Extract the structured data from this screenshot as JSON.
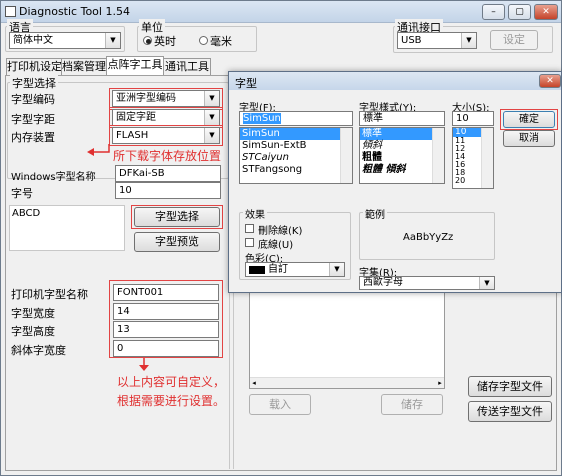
{
  "window": {
    "title": "Diagnostic Tool 1.54",
    "min": "–",
    "max": "▢",
    "close": "✕"
  },
  "language": {
    "label": "语言",
    "value": "简体中文"
  },
  "unit": {
    "label": "单位",
    "option_mm": "英时",
    "option_cm": "毫米",
    "selected": "英时"
  },
  "comm": {
    "label": "通讯接口",
    "value": "USB",
    "settings_button": "设定"
  },
  "tabs": [
    "打印机设定",
    "档案管理",
    "点阵字工具",
    "通讯工具"
  ],
  "active_tab": "点阵字工具",
  "font_select_group": {
    "title": "字型选择",
    "encoding_label": "字型编码",
    "encoding_value": "亚洲字型编码",
    "spacing_label": "字型字距",
    "spacing_value": "固定字距",
    "memory_label": "内存装置",
    "memory_value": "FLASH",
    "win_font_label": "Windows字型名称",
    "win_font_value": "DFKai-SB",
    "size_label": "字号",
    "size_value": "10",
    "sample_text": "ABCD",
    "select_font_button": "字型选择",
    "preview_button": "字型预览"
  },
  "printer_font": {
    "name_label": "打印机字型名称",
    "name_value": "FONT001",
    "width_label": "字型宽度",
    "width_value": "14",
    "height_label": "字型高度",
    "height_value": "13",
    "italic_label": "斜体字宽度",
    "italic_value": "0"
  },
  "annotations": {
    "download_location": "所下载字体存放位置",
    "custom_line1": "以上内容可自定义，",
    "custom_line2": "根据需要进行设置。"
  },
  "bottom_buttons": {
    "load": "载入",
    "save": "储存",
    "save_font_file": "储存字型文件",
    "send_font_file": "传送字型文件"
  },
  "font_dialog": {
    "title": "字型",
    "font_label": "字型(F):",
    "font_value": "SimSun",
    "fonts": [
      "SimSun",
      "SimSun-ExtB",
      "STCaiyun",
      "STFangsong"
    ],
    "selected_font": "SimSun",
    "style_label": "字型樣式(Y):",
    "style_value": "標準",
    "styles": [
      "標準",
      "傾斜",
      "粗體",
      "粗體 傾斜"
    ],
    "selected_style": "標準",
    "size_label": "大小(S):",
    "size_value": "10",
    "sizes": [
      "10",
      "11",
      "12",
      "14",
      "16",
      "18",
      "20"
    ],
    "selected_size": "10",
    "ok_button": "確定",
    "cancel_button": "取消",
    "effects_title": "效果",
    "strikeout": "刪除線(K)",
    "underline": "底線(U)",
    "color_label": "色彩(C):",
    "color_value": "自訂",
    "color_swatch": "#000000",
    "sample_title": "範例",
    "sample_text": "AaBbYyZz",
    "script_label": "字集(R):",
    "script_value": "西歐字母"
  },
  "colors": {
    "annotation_red": "#e03030"
  }
}
